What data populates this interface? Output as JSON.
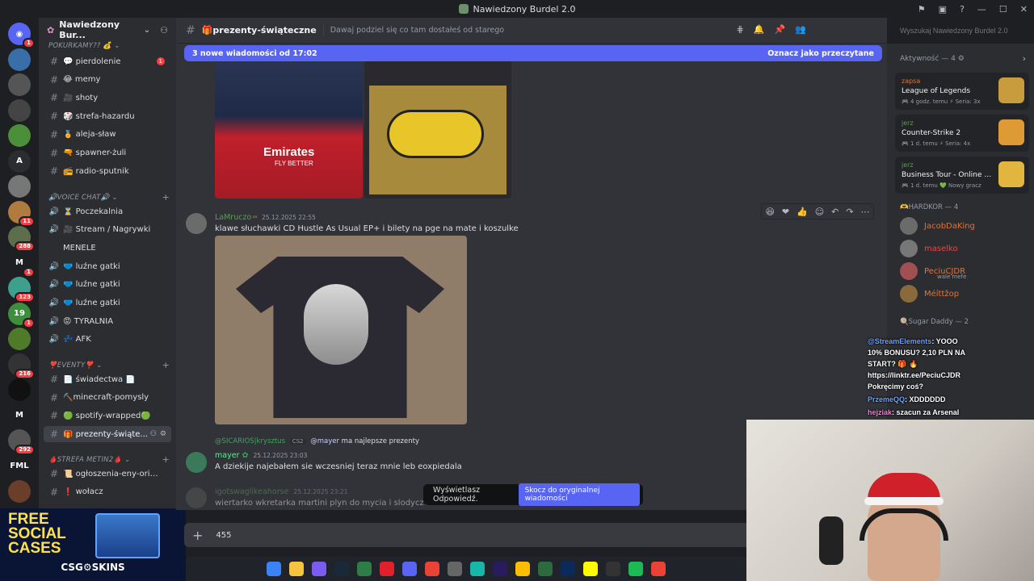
{
  "window": {
    "title": "Nawiedzony Burdel 2.0"
  },
  "servers": [
    {
      "name": "discord-home",
      "badge": "1",
      "color": "#5865f2",
      "glyph": "◉"
    },
    {
      "name": "server-2",
      "badge": "",
      "color": "#3a6ea8",
      "glyph": ""
    },
    {
      "name": "server-3",
      "badge": "",
      "color": "#555",
      "glyph": ""
    },
    {
      "name": "server-4",
      "badge": "",
      "color": "#444",
      "glyph": ""
    },
    {
      "name": "server-5",
      "badge": "",
      "color": "#4b8f3b",
      "glyph": ""
    },
    {
      "name": "server-A",
      "badge": "",
      "color": "#2b2d31",
      "glyph": "A"
    },
    {
      "name": "server-7",
      "badge": "",
      "color": "#777",
      "glyph": ""
    },
    {
      "name": "server-8",
      "badge": "11",
      "color": "#b07b3e",
      "glyph": ""
    },
    {
      "name": "server-9",
      "badge": "288",
      "color": "#5c6e4b",
      "glyph": ""
    },
    {
      "name": "server-M",
      "badge": "1",
      "color": "#1e1f22",
      "glyph": "M"
    },
    {
      "name": "server-11",
      "badge": "123",
      "color": "#3ea08c",
      "glyph": ""
    },
    {
      "name": "server-12",
      "badge": "1",
      "color": "#3d8e3d",
      "glyph": "19"
    },
    {
      "name": "server-13",
      "badge": "",
      "color": "#4f7a2a",
      "glyph": ""
    },
    {
      "name": "server-14",
      "badge": "216",
      "color": "#333",
      "glyph": ""
    },
    {
      "name": "server-15",
      "badge": "",
      "color": "#111",
      "glyph": ""
    },
    {
      "name": "server-16",
      "badge": "",
      "color": "#1e1f22",
      "glyph": "M"
    },
    {
      "name": "server-17",
      "badge": "292",
      "color": "#555",
      "glyph": ""
    },
    {
      "name": "server-FML",
      "badge": "",
      "color": "#1e1f22",
      "glyph": "FML"
    },
    {
      "name": "server-19",
      "badge": "",
      "color": "#6a3e2a",
      "glyph": ""
    }
  ],
  "sidebar": {
    "server_name": "Nawiedzony Bur...",
    "categories": {
      "pokurkamy": "POKURKAMY?? 💰",
      "voice": "🔊VOICE CHAT🔊",
      "event": "❣️EVENTY❣️",
      "metin": "🩸STREFA METIN2🩸"
    },
    "channels": [
      {
        "id": "pierdolenie",
        "label": "💬 pierdolenie",
        "badge": "1"
      },
      {
        "id": "memy",
        "label": "😂 memy"
      },
      {
        "id": "shoty",
        "label": "🎥 shoty"
      },
      {
        "id": "strefa-hazardu",
        "label": "🎲 strefa-hazardu"
      },
      {
        "id": "aleja-slaw",
        "label": "🏅 aleja-sław"
      },
      {
        "id": "spawner-zuli",
        "label": "🔫 spawner-żuli"
      },
      {
        "id": "radio-sputnik",
        "label": "📻 radio-sputnik"
      }
    ],
    "voice_channels": [
      {
        "id": "poczekalnia",
        "label": "⏳ Poczekalnia"
      },
      {
        "id": "stream",
        "label": "🎥 Stream / Nagrywki"
      },
      {
        "id": "menele",
        "label": "MENELE"
      },
      {
        "id": "luzne-1",
        "label": "🩲 luźne gatki"
      },
      {
        "id": "luzne-2",
        "label": "🩲 luźne gatki"
      },
      {
        "id": "luzne-3",
        "label": "🩲 luźne gatki"
      },
      {
        "id": "tyralnia",
        "label": "😡 TYRALNIA"
      },
      {
        "id": "afk",
        "label": "💤 AFK"
      }
    ],
    "event_channels": [
      {
        "id": "swiadectwa",
        "label": "📄 świadectwa 📄"
      },
      {
        "id": "minecraft",
        "label": "⛏️minecraft-pomysly"
      },
      {
        "id": "spotify",
        "label": "🟢 spotify-wrapped🟢"
      },
      {
        "id": "prezenty",
        "label": "🎁 prezenty-świąte..."
      }
    ],
    "metin_channels": [
      {
        "id": "ogloszenia",
        "label": "📜 ogłoszenia-eny-origins"
      },
      {
        "id": "wolacz",
        "label": "❗ wołacz"
      }
    ]
  },
  "promo": {
    "line1": "FREE",
    "line2": "SOCIAL",
    "line3": "CASES",
    "brand": "CSG⚙SKINS"
  },
  "header": {
    "channel": "🎁prezenty-świąteczne",
    "topic": "Dawaj podziel się co tam dostałeś od starego",
    "search_placeholder": "Wyszukaj Nawiedzony Burdel 2.0"
  },
  "newbar": {
    "text": "3 nowe wiadomości od 17:02",
    "mark": "Oznacz jako przeczytane"
  },
  "messages": {
    "m1": {
      "user": "LaMruczo",
      "time": "25.12.2025 22:55",
      "text": "klawe słuchawki  CD Hustle As Usual EP+ i bilety na pge na mate i koszulke"
    },
    "reply_ref": {
      "user": "@SICARIOS|krysztus",
      "tag": "CS2",
      "mention": "@mayer",
      "text": "ma najlepsze prezenty"
    },
    "m2": {
      "user": "mayer",
      "time": "25.12.2025 23:03",
      "text": "A dziekije najebałem sie wczesniej teraz mnie leb eoxpiedala"
    },
    "m3": {
      "user": "igotswaglikeahorse",
      "time": "25.12.2025 23:21",
      "text": "wiertarko wkretarka martini plyn do mycia i slodycze i siatk"
    }
  },
  "shirt_image": {
    "line1": "Emirates",
    "line2": "FLY BETTER"
  },
  "reply_toast": {
    "text": "Wyświetlasz Odpowiedź.",
    "jump": "Skocz do oryginalnej wiadomości"
  },
  "composer": {
    "value": "455"
  },
  "members": {
    "activity_header": "Aktywność — 4",
    "activities": [
      {
        "user": "zapsa",
        "game": "League of Legends",
        "meta": "🎮 4 godz. temu  ⚡ Seria: 3x",
        "color": "#c89b3c"
      },
      {
        "user": "jerz",
        "game": "Counter-Strike 2",
        "meta": "🎮 1 d. temu  ⚡ Seria: 4x",
        "color": "#de9b35"
      },
      {
        "user": "jerz",
        "game": "Business Tour - Online Mul...",
        "meta": "🎮 1 d. temu  💚 Nowy gracz",
        "color": "#e2b53e"
      }
    ],
    "hardkor_header": "🫶HARDKOR — 4",
    "hardkor": [
      {
        "name": "JacobDaKing",
        "sub": ""
      },
      {
        "name": "maselko",
        "sub": ""
      },
      {
        "name": "PeciuCJDR",
        "sub": "wale mefe"
      },
      {
        "name": "Méíttžop",
        "sub": ""
      }
    ],
    "sugar_header": "🍭Sugar Daddy — 2"
  },
  "overlay": {
    "l1_name": "@StreamElements",
    "l1_text": ": YOOO",
    "l2": "10% BONUSU? 2,10 PLN NA",
    "l3": "START? 🎁 🔥",
    "l4": "https://linktr.ee/PeciuCJDR",
    "l5": "Pokręcimy coś?",
    "l6_name": "PrzemeQQ",
    "l6_text": ": XDDDDDD",
    "l7_name": "hejziak",
    "l7_text": ": szacun za Arsenal"
  },
  "taskbar": [
    "windows",
    "files",
    "copilot",
    "steam",
    "app5",
    "opera",
    "discord",
    "chrome-red",
    "app9",
    "app10",
    "premiere",
    "chrome",
    "app13",
    "photoshop",
    "snapchat",
    "app16",
    "spotify",
    "chrome2"
  ]
}
